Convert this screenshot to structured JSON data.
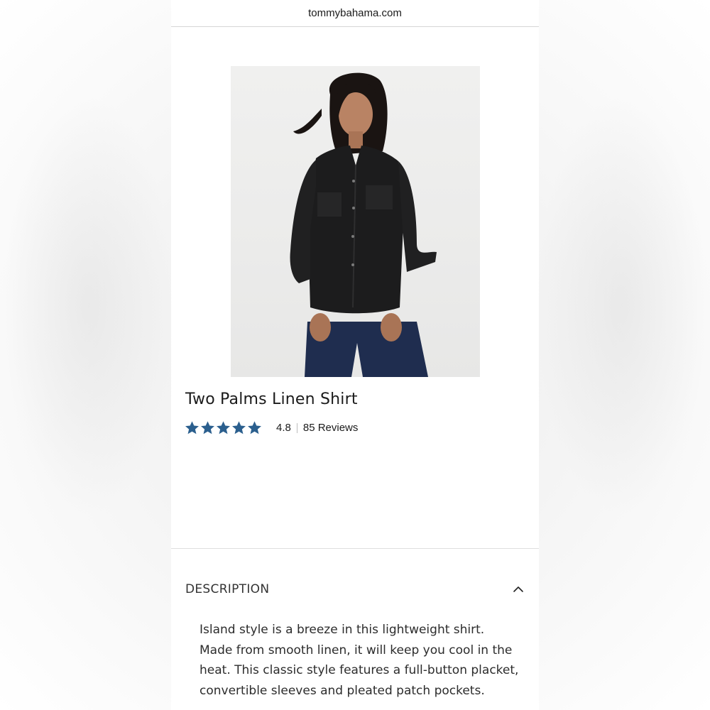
{
  "browser": {
    "url": "tommybahama.com"
  },
  "product": {
    "image_alt": "Woman wearing black linen button-up shirt",
    "title": "Two Palms Linen Shirt",
    "rating": {
      "stars": 5,
      "value": "4.8",
      "reviews_label": "85 Reviews"
    }
  },
  "description": {
    "heading": "DESCRIPTION",
    "expanded": true,
    "text": "Island style is a breeze in this lightweight shirt. Made from smooth linen, it will keep you cool in the heat. This classic style features a full-button placket, convertible sleeves and pleated patch pockets."
  },
  "colors": {
    "star": "#2b5f8e",
    "page_background": "#ffffff",
    "text": "#1b1b1b"
  },
  "icons": {
    "star": "star-icon",
    "chevron": "chevron-up-icon"
  }
}
